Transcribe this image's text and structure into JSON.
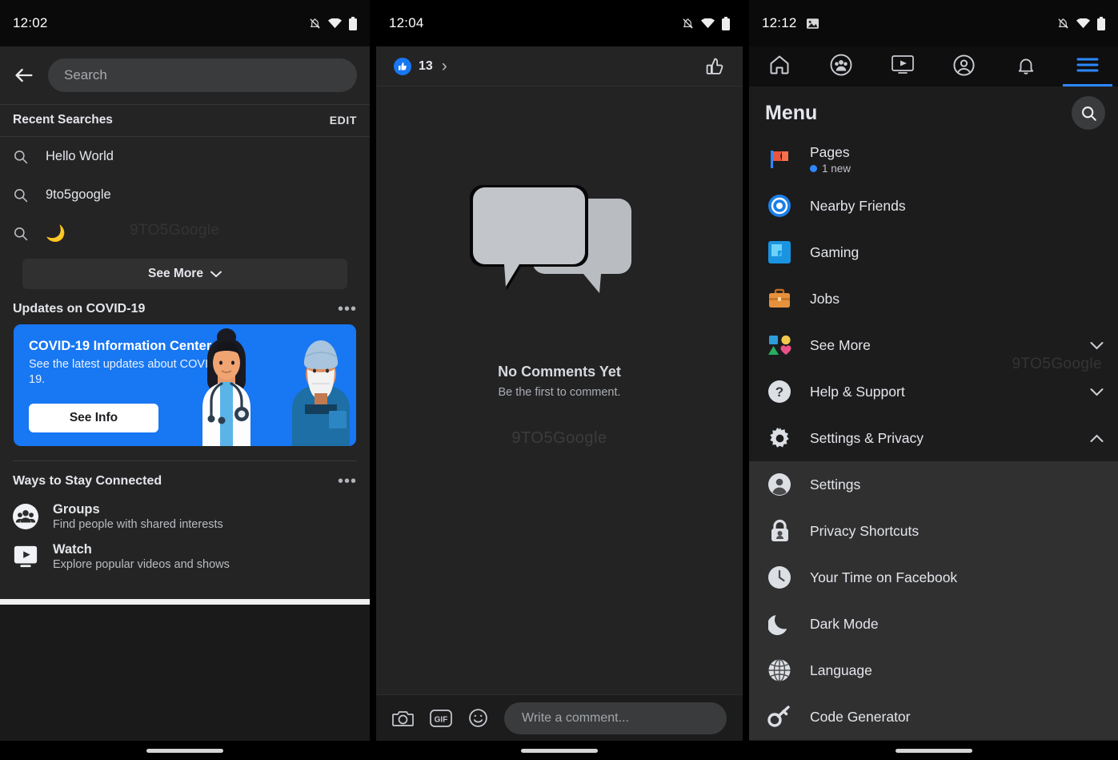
{
  "watermark": "9TO5Google",
  "colors": {
    "accent_blue": "#1877f2",
    "nav_blue": "#2d88ff",
    "panel_bg": "#1c1c1d",
    "surface": "#242424",
    "submenu_bg": "#303031",
    "text_primary": "#e4e6eb",
    "text_secondary": "#b0b3b8"
  },
  "panel1": {
    "status": {
      "time": "12:02",
      "icons": [
        "bell-muted-icon",
        "wifi-icon",
        "battery-icon"
      ]
    },
    "search": {
      "placeholder": "Search",
      "back_icon": "back-arrow-icon"
    },
    "recent_header": {
      "title": "Recent Searches",
      "action": "EDIT"
    },
    "recent_items": [
      {
        "label": "Hello World",
        "icon": "search-icon"
      },
      {
        "label": "9to5google",
        "icon": "search-icon"
      },
      {
        "label": "🌙",
        "icon": "search-icon"
      }
    ],
    "see_more": {
      "label": "See More",
      "icon": "chevron-down-icon"
    },
    "covid_section": {
      "title": "Updates on COVID-19",
      "menu_icon": "overflow-dots-icon",
      "card": {
        "heading": "COVID-19 Information Center",
        "body": "See the latest updates about COVID-19.",
        "button": "See Info"
      }
    },
    "ways_section": {
      "title": "Ways to Stay Connected",
      "menu_icon": "overflow-dots-icon",
      "items": [
        {
          "title": "Groups",
          "subtitle": "Find people with shared interests",
          "icon": "groups-icon"
        },
        {
          "title": "Watch",
          "subtitle": "Explore popular videos and shows",
          "icon": "watch-icon"
        }
      ]
    }
  },
  "panel2": {
    "status": {
      "time": "12:04",
      "icons": [
        "bell-muted-icon",
        "wifi-icon",
        "battery-icon"
      ]
    },
    "reactions": {
      "count": "13",
      "like_icon": "thumbs-up-filled-icon",
      "chevron": "›",
      "action_icon": "thumbs-up-outline-icon"
    },
    "empty_state": {
      "illustration": "two-speech-bubbles-icon",
      "title": "No Comments Yet",
      "subtitle": "Be the first to comment."
    },
    "composer": {
      "placeholder": "Write a comment...",
      "buttons": [
        "camera-icon",
        "gif-icon",
        "emoji-icon"
      ]
    }
  },
  "panel3": {
    "status": {
      "time": "12:12",
      "left_icon": "image-icon",
      "icons": [
        "bell-muted-icon",
        "wifi-icon",
        "battery-icon"
      ]
    },
    "nav": [
      {
        "name": "home-icon",
        "active": false
      },
      {
        "name": "friends-icon",
        "active": false
      },
      {
        "name": "watch-icon",
        "active": false
      },
      {
        "name": "profile-icon",
        "active": false
      },
      {
        "name": "notifications-bell-icon",
        "active": false
      },
      {
        "name": "hamburger-menu-icon",
        "active": true
      }
    ],
    "header": {
      "title": "Menu",
      "search_icon": "search-icon"
    },
    "items": [
      {
        "label": "Pages",
        "icon": "pages-flag-icon",
        "badge": "1 new",
        "chevron": null,
        "sub": false
      },
      {
        "label": "Nearby Friends",
        "icon": "nearby-friends-icon",
        "badge": null,
        "chevron": null,
        "sub": false
      },
      {
        "label": "Gaming",
        "icon": "gaming-icon",
        "badge": null,
        "chevron": null,
        "sub": false
      },
      {
        "label": "Jobs",
        "icon": "jobs-briefcase-icon",
        "badge": null,
        "chevron": null,
        "sub": false
      },
      {
        "label": "See More",
        "icon": "see-more-shapes-icon",
        "badge": null,
        "chevron": "down",
        "sub": false
      },
      {
        "label": "Help & Support",
        "icon": "help-question-icon",
        "badge": null,
        "chevron": "down",
        "sub": false
      },
      {
        "label": "Settings & Privacy",
        "icon": "gear-icon",
        "badge": null,
        "chevron": "up",
        "sub": false
      },
      {
        "label": "Settings",
        "icon": "account-circle-icon",
        "badge": null,
        "chevron": null,
        "sub": true
      },
      {
        "label": "Privacy Shortcuts",
        "icon": "lock-icon",
        "badge": null,
        "chevron": null,
        "sub": true
      },
      {
        "label": "Your Time on Facebook",
        "icon": "clock-icon",
        "badge": null,
        "chevron": null,
        "sub": true
      },
      {
        "label": "Dark Mode",
        "icon": "moon-icon",
        "badge": null,
        "chevron": null,
        "sub": true
      },
      {
        "label": "Language",
        "icon": "globe-icon",
        "badge": null,
        "chevron": null,
        "sub": true
      },
      {
        "label": "Code Generator",
        "icon": "key-icon",
        "badge": null,
        "chevron": null,
        "sub": true
      }
    ]
  }
}
